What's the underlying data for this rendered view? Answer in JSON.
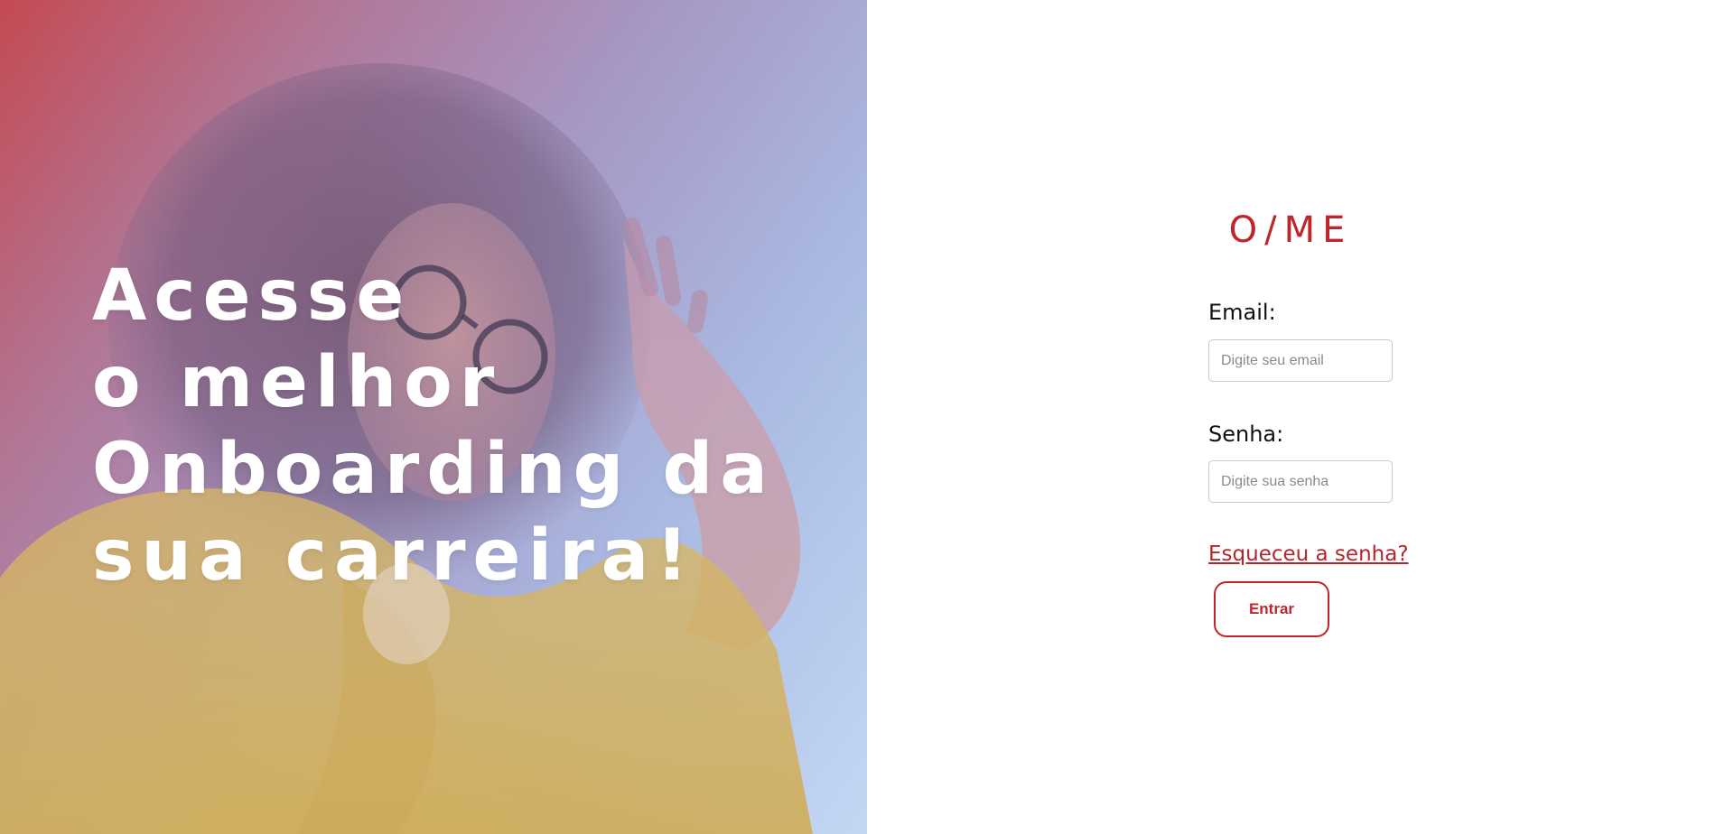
{
  "hero": {
    "headline_lines": [
      "Acesse",
      "o melhor",
      "Onboarding da",
      "sua carreira!"
    ],
    "image": "woman-with-glasses-waving-photo"
  },
  "brand": {
    "logo_text": "O/ME",
    "color": "#c0252b"
  },
  "login_form": {
    "email_label": "Email:",
    "email_placeholder": "Digite seu email",
    "email_value": "",
    "password_label": "Senha:",
    "password_placeholder": "Digite sua senha",
    "password_value": "",
    "forgot_password_link": "Esqueceu a senha?",
    "submit_label": "Entrar"
  }
}
